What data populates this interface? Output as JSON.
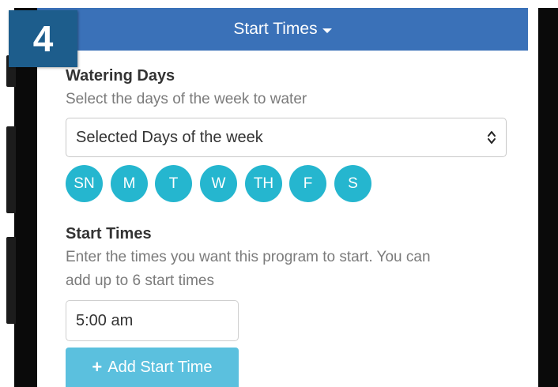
{
  "step_badge": "4",
  "header": {
    "title": "Start Times",
    "caret_icon": "caret-down-icon"
  },
  "watering_days": {
    "title": "Watering Days",
    "helper": "Select the days of the week to water",
    "select_value": "Selected Days of the week",
    "select_icon": "select-updown-icon",
    "days": [
      "SN",
      "M",
      "T",
      "W",
      "TH",
      "F",
      "S"
    ],
    "day_color": "#25b6cf"
  },
  "start_times": {
    "title": "Start Times",
    "helper_line1": "Enter the times you want this program to start. You can",
    "helper_line2": "add up to 6 start times",
    "time_value": "5:00 am",
    "add_button_label": "Add Start Time",
    "add_button_icon": "plus-icon",
    "add_button_color": "#5bc0de"
  },
  "colors": {
    "header": "#3a71b8",
    "badge": "#1d5d8c"
  }
}
